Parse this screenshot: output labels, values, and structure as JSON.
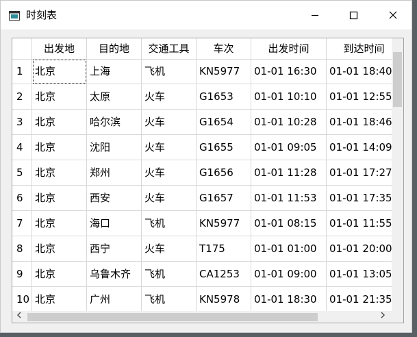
{
  "window": {
    "title": "时刻表"
  },
  "table": {
    "headers": [
      "出发地",
      "目的地",
      "交通工具",
      "车次",
      "出发时间",
      "到达时间"
    ],
    "rows": [
      {
        "num": "1",
        "cells": [
          "北京",
          "上海",
          "飞机",
          "KN5977",
          "01-01 16:30",
          "01-01 18:40"
        ]
      },
      {
        "num": "2",
        "cells": [
          "北京",
          "太原",
          "火车",
          "G1653",
          "01-01 10:10",
          "01-01 12:55"
        ]
      },
      {
        "num": "3",
        "cells": [
          "北京",
          "哈尔滨",
          "火车",
          "G1654",
          "01-01 10:28",
          "01-01 18:46"
        ]
      },
      {
        "num": "4",
        "cells": [
          "北京",
          "沈阳",
          "火车",
          "G1655",
          "01-01 09:05",
          "01-01 14:09"
        ]
      },
      {
        "num": "5",
        "cells": [
          "北京",
          "郑州",
          "火车",
          "G1656",
          "01-01 11:28",
          "01-01 17:27"
        ]
      },
      {
        "num": "6",
        "cells": [
          "北京",
          "西安",
          "火车",
          "G1657",
          "01-01 11:53",
          "01-01 17:35"
        ]
      },
      {
        "num": "7",
        "cells": [
          "北京",
          "海口",
          "飞机",
          "KN5977",
          "01-01 08:15",
          "01-01 11:55"
        ]
      },
      {
        "num": "8",
        "cells": [
          "北京",
          "西宁",
          "火车",
          "T175",
          "01-01 01:00",
          "01-01 20:00"
        ]
      },
      {
        "num": "9",
        "cells": [
          "北京",
          "乌鲁木齐",
          "飞机",
          "CA1253",
          "01-01 09:00",
          "01-01 13:05"
        ]
      },
      {
        "num": "10",
        "cells": [
          "北京",
          "广州",
          "飞机",
          "KN5978",
          "01-01 18:30",
          "01-01 21:35"
        ]
      }
    ]
  },
  "icons": {
    "app": "window-app-icon",
    "minimize": "minimize-icon",
    "maximize": "maximize-icon",
    "close": "close-icon",
    "scroll_left": "chevron-left-icon",
    "scroll_right": "chevron-right-icon"
  }
}
